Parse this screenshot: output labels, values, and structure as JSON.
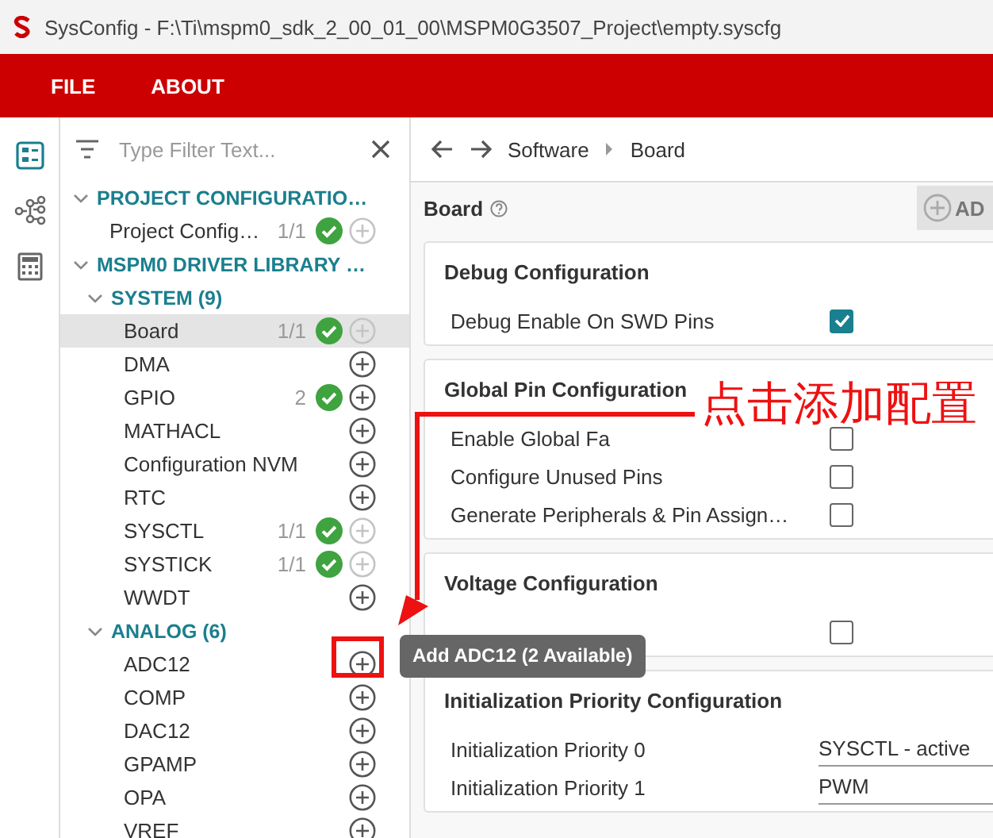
{
  "window": {
    "title": "SysConfig - F:\\Ti\\mspm0_sdk_2_00_01_00\\MSPM0G3507_Project\\empty.syscfg"
  },
  "menu": [
    "FILE",
    "ABOUT"
  ],
  "rail": [
    {
      "kind": "list",
      "selected": true
    },
    {
      "kind": "tree",
      "selected": false
    },
    {
      "kind": "calculator",
      "selected": false
    }
  ],
  "filter": {
    "placeholder": "Type Filter Text..."
  },
  "tree": [
    {
      "label": "PROJECT CONFIGURATIO…",
      "expanded": true,
      "children": [
        {
          "label": "Project Config…",
          "selected": false,
          "count": "1/1",
          "ok": true,
          "add_disabled": true
        }
      ]
    },
    {
      "label": "MSPM0 DRIVER LIBRARY …",
      "expanded": true,
      "children": [
        {
          "label": "SYSTEM (9)",
          "expanded": true,
          "children": [
            {
              "label": "Board",
              "selected": true,
              "count": "1/1",
              "ok": true,
              "add_disabled": true
            },
            {
              "label": "DMA",
              "selected": false,
              "add_disabled": false
            },
            {
              "label": "GPIO",
              "selected": false,
              "count": "2",
              "ok": true,
              "add_disabled": false
            },
            {
              "label": "MATHACL",
              "selected": false,
              "add_disabled": false
            },
            {
              "label": "Configuration NVM",
              "selected": false,
              "add_disabled": false
            },
            {
              "label": "RTC",
              "selected": false,
              "add_disabled": false
            },
            {
              "label": "SYSCTL",
              "selected": false,
              "count": "1/1",
              "ok": true,
              "add_disabled": true
            },
            {
              "label": "SYSTICK",
              "selected": false,
              "count": "1/1",
              "ok": true,
              "add_disabled": true
            },
            {
              "label": "WWDT",
              "selected": false,
              "add_disabled": false
            }
          ]
        },
        {
          "label": "ANALOG (6)",
          "expanded": true,
          "children": [
            {
              "label": "ADC12",
              "selected": false,
              "add_disabled": false
            },
            {
              "label": "COMP",
              "selected": false,
              "add_disabled": false
            },
            {
              "label": "DAC12",
              "selected": false,
              "add_disabled": false
            },
            {
              "label": "GPAMP",
              "selected": false,
              "add_disabled": false
            },
            {
              "label": "OPA",
              "selected": false,
              "add_disabled": false
            },
            {
              "label": "VREF",
              "selected": false,
              "add_disabled": false
            }
          ]
        }
      ]
    }
  ],
  "breadcrumb": [
    "Software",
    "Board"
  ],
  "page": {
    "title": "Board",
    "add_button": "AD"
  },
  "cards": [
    {
      "title": "Debug Configuration",
      "rows": [
        {
          "kind": "checkbox",
          "label": "Debug Enable On SWD Pins",
          "checked": true
        }
      ]
    },
    {
      "title": "Global Pin Configuration",
      "rows": [
        {
          "kind": "checkbox",
          "label": "Enable Global Fa",
          "checked": false
        },
        {
          "kind": "checkbox",
          "label": "Configure Unused Pins",
          "checked": false
        },
        {
          "kind": "checkbox",
          "label": "Generate Peripherals & Pin Assign…",
          "checked": false
        }
      ]
    },
    {
      "title": "Voltage Configuration",
      "rows": [
        {
          "kind": "checkbox",
          "checked": false
        }
      ]
    },
    {
      "title": "Initialization Priority Configuration",
      "rows": [
        {
          "kind": "select",
          "label": "Initialization Priority 0",
          "value": "SYSCTL - active"
        },
        {
          "kind": "select",
          "label": "Initialization Priority 1",
          "value": "PWM"
        }
      ]
    }
  ],
  "tooltip": "Add ADC12 (2 Available)",
  "annotation": "点击添加配置"
}
